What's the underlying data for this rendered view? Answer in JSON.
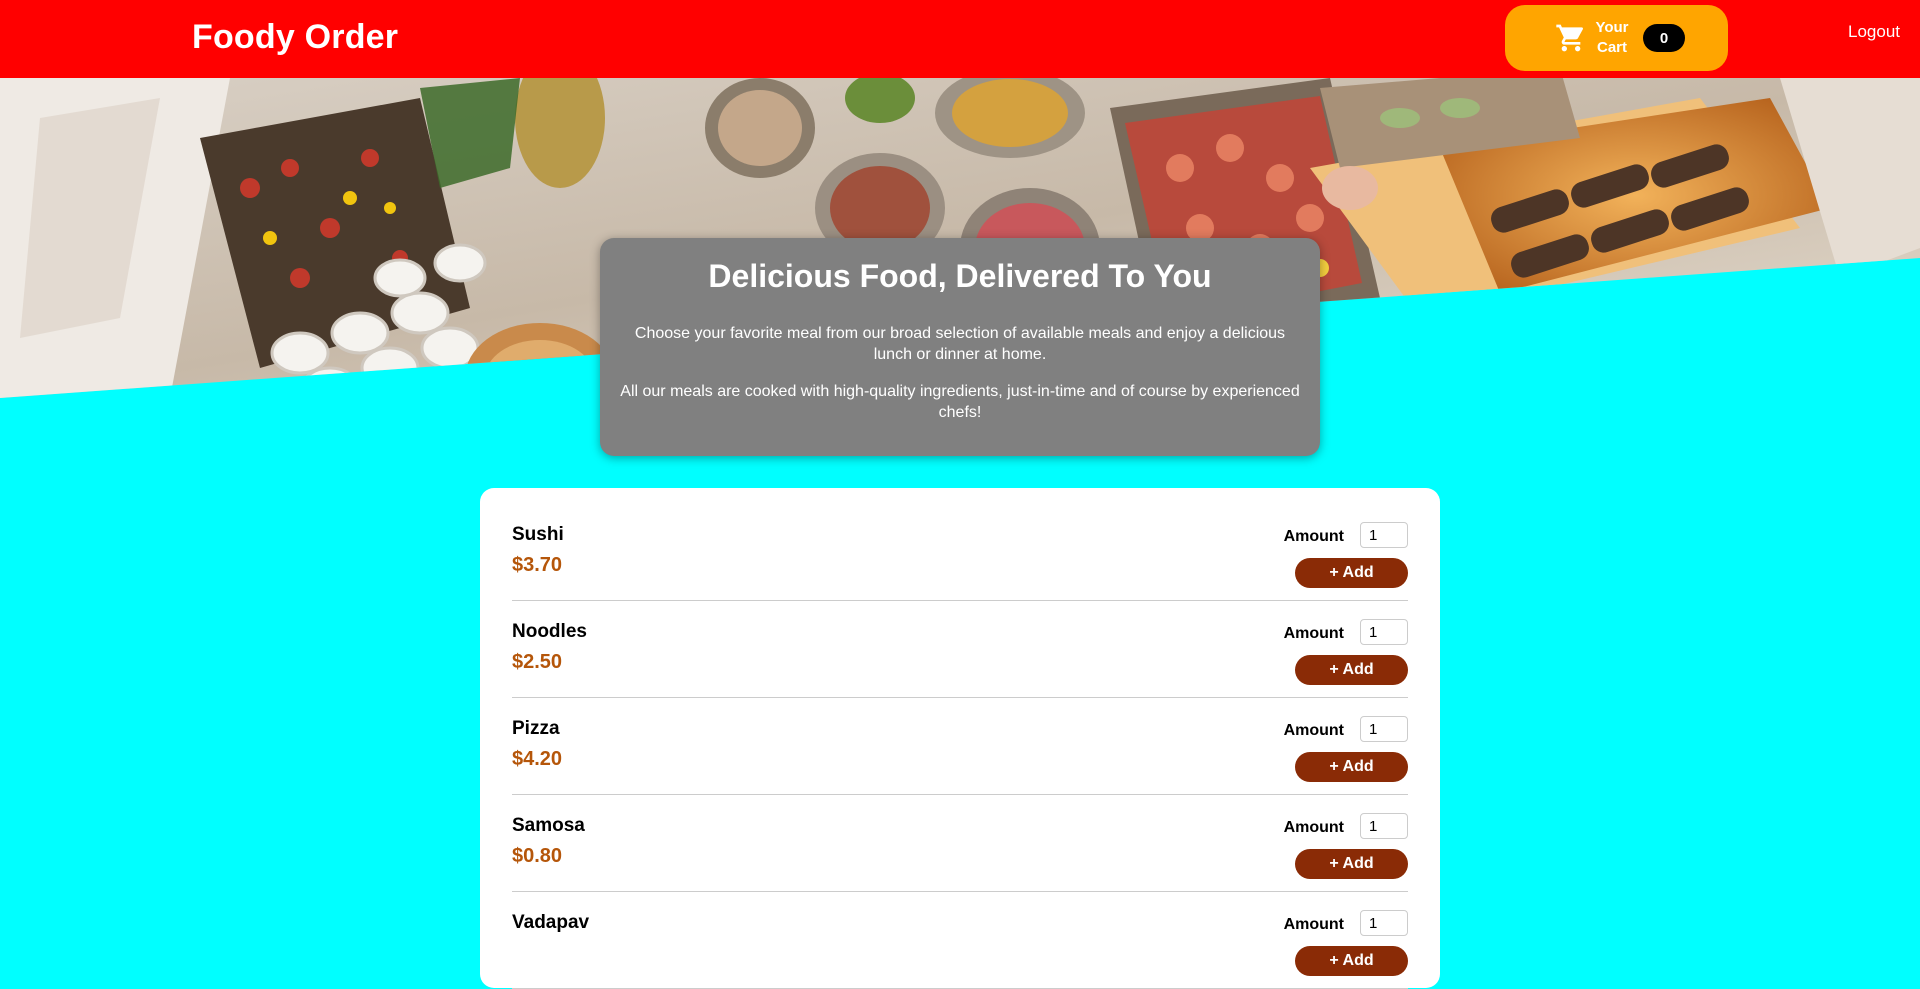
{
  "header": {
    "brand": "Foody Order",
    "cart_label": "Your Cart",
    "cart_count": "0",
    "logout_label": "Logout"
  },
  "hero": {
    "image_icon": "food-buffet-photo"
  },
  "summary": {
    "title": "Delicious Food, Delivered To You",
    "paragraph_1": "Choose your favorite meal from our broad selection of available meals and enjoy a delicious lunch or dinner at home.",
    "paragraph_2": "All our meals are cooked with high-quality ingredients, just-in-time and of course by experienced chefs!"
  },
  "meals": {
    "amount_label": "Amount",
    "add_label": "+ Add",
    "items": [
      {
        "name": "Sushi",
        "price": "$3.70",
        "amount": "1"
      },
      {
        "name": "Noodles",
        "price": "$2.50",
        "amount": "1"
      },
      {
        "name": "Pizza",
        "price": "$4.20",
        "amount": "1"
      },
      {
        "name": "Samosa",
        "price": "$0.80",
        "amount": "1"
      },
      {
        "name": "Vadapav",
        "price": "",
        "amount": "1"
      }
    ]
  },
  "colors": {
    "header_bg": "#ff0000",
    "cart_bg": "#ffa500",
    "page_bg": "#00ffff",
    "summary_bg": "#808080",
    "price": "#b5560a",
    "add_button": "#8a2b06"
  }
}
